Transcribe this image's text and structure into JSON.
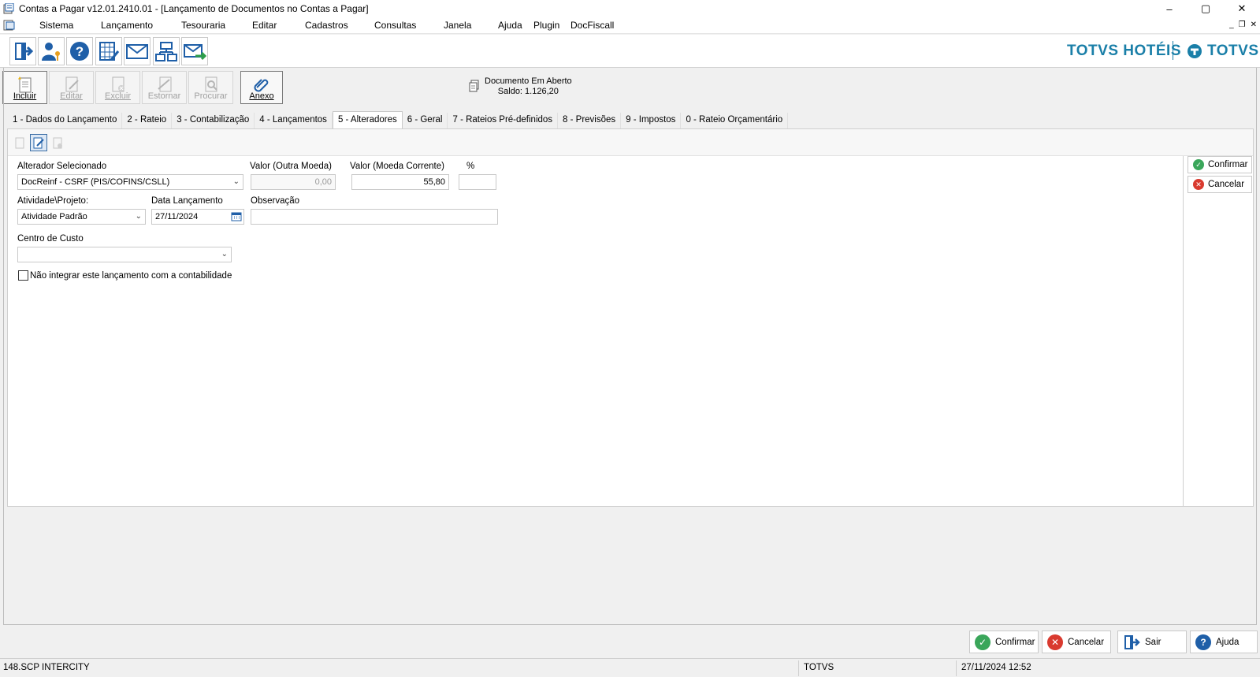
{
  "window": {
    "title": "Contas a Pagar v12.01.2410.01 - [Lançamento de Documentos no Contas a Pagar]",
    "controls": {
      "minimize": "–",
      "maximize": "▢",
      "close": "✕"
    }
  },
  "menu": {
    "items": [
      "Sistema",
      "Lançamento",
      "Tesouraria",
      "Editar",
      "Cadastros",
      "Consultas",
      "Janela",
      "Ajuda",
      "Plugin",
      "DocFiscall"
    ]
  },
  "brand": {
    "left": "TOTVS HOTÉIS",
    "right": "TOTVS"
  },
  "actions": {
    "incluir": "Incluir",
    "editar": "Editar",
    "excluir": "Excluir",
    "estornar": "Estornar",
    "procurar": "Procurar",
    "anexo": "Anexo"
  },
  "document_status": {
    "line1": "Documento Em Aberto",
    "line2": "Saldo: 1.126,20"
  },
  "tabs": [
    "1 - Dados do Lançamento",
    "2 - Rateio",
    "3 - Contabilização",
    "4 - Lançamentos",
    "5 - Alteradores",
    "6 - Geral",
    "7 - Rateios Pré-definidos",
    "8 - Previsões",
    "9 - Impostos",
    "0 - Rateio Orçamentário"
  ],
  "form": {
    "alterador_label": "Alterador Selecionado",
    "alterador_value": "DocReinf - CSRF (PIS/COFINS/CSLL)",
    "valor_outra_label": "Valor (Outra Moeda)",
    "valor_outra_value": "0,00",
    "valor_corrente_label": "Valor (Moeda Corrente)",
    "valor_corrente_value": "55,80",
    "percent_label": "%",
    "percent_value": "",
    "atividade_label": "Atividade\\Projeto:",
    "atividade_value": "Atividade Padrão",
    "data_label": "Data Lançamento",
    "data_value": "27/11/2024",
    "observacao_label": "Observação",
    "observacao_value": "",
    "centro_label": "Centro de Custo",
    "centro_value": "",
    "nao_integrar_label": "Não integrar este lançamento com a contabilidade",
    "nao_integrar_checked": false
  },
  "side_buttons": {
    "confirmar": "Confirmar",
    "cancelar": "Cancelar"
  },
  "bottom_buttons": {
    "confirmar": "Confirmar",
    "cancelar": "Cancelar",
    "sair": "Sair",
    "ajuda": "Ajuda"
  },
  "status": {
    "company": "148.SCP INTERCITY",
    "system": "TOTVS",
    "datetime": "27/11/2024 12:52"
  },
  "colors": {
    "brand": "#1a7fa8",
    "confirm": "#3aa65a",
    "cancel": "#d93a2f",
    "help": "#1f5fa8"
  }
}
